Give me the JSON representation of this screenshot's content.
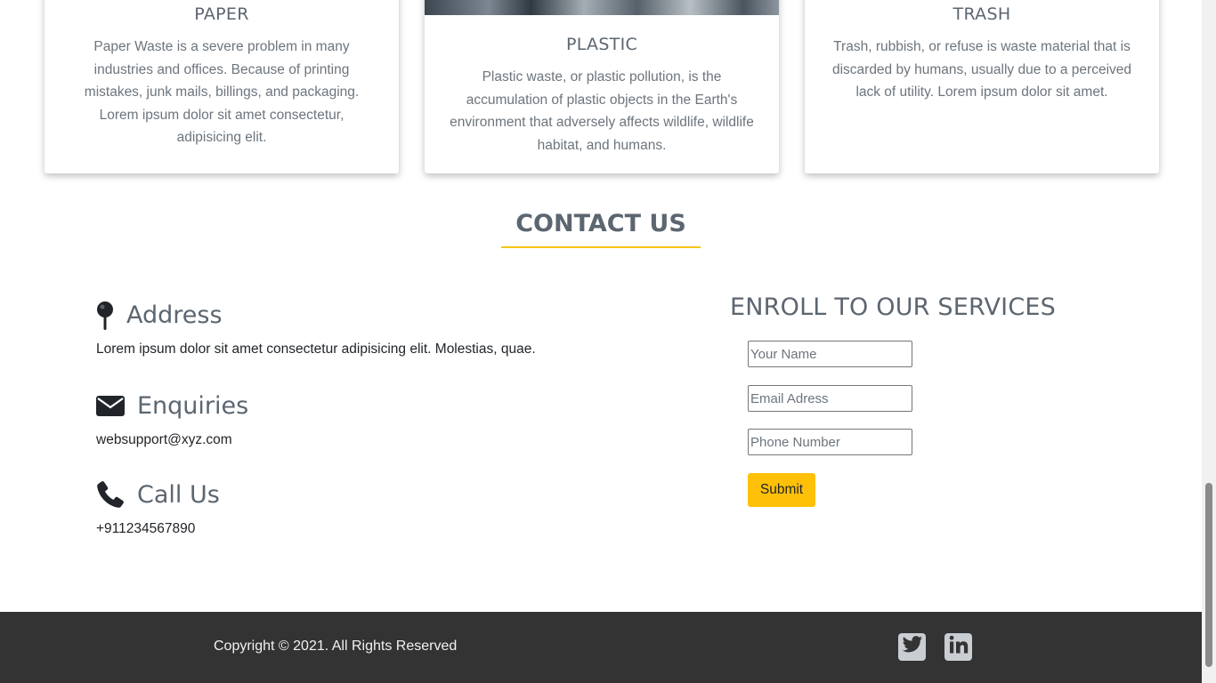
{
  "cards": [
    {
      "title": "PAPER",
      "text": "Paper Waste is a severe problem in many industries and offices. Because of printing mistakes, junk mails, billings, and packaging. Lorem ipsum dolor sit amet consectetur, adipisicing elit."
    },
    {
      "title": "PLASTIC",
      "text": "Plastic waste, or plastic pollution, is the accumulation of plastic objects in the Earth's environment that adversely affects wildlife, wildlife habitat, and humans."
    },
    {
      "title": "TRASH",
      "text": "Trash, rubbish, or refuse is waste material that is discarded by humans, usually due to a perceived lack of utility. Lorem ipsum dolor sit amet."
    }
  ],
  "contact": {
    "title": "CONTACT US",
    "address": {
      "heading": "Address",
      "text": "Lorem ipsum dolor sit amet consectetur adipisicing elit. Molestias, quae.",
      "icon": "map-pin-icon"
    },
    "enquiries": {
      "heading": "Enquiries",
      "text": "websupport@xyz.com",
      "icon": "envelope-icon"
    },
    "call": {
      "heading": "Call Us",
      "text": "+911234567890",
      "icon": "phone-icon"
    }
  },
  "enroll": {
    "title": "ENROLL TO OUR SERVICES",
    "name_placeholder": "Your Name",
    "email_placeholder": "Email Adress",
    "phone_placeholder": "Phone Number",
    "submit_label": "Submit"
  },
  "footer": {
    "copyright": "Copyright © 2021. All Rights Reserved",
    "social": [
      "twitter-icon",
      "linkedin-icon"
    ]
  },
  "colors": {
    "accent": "#ffc107",
    "heading": "#5c6670",
    "footer_bg": "#333333"
  }
}
